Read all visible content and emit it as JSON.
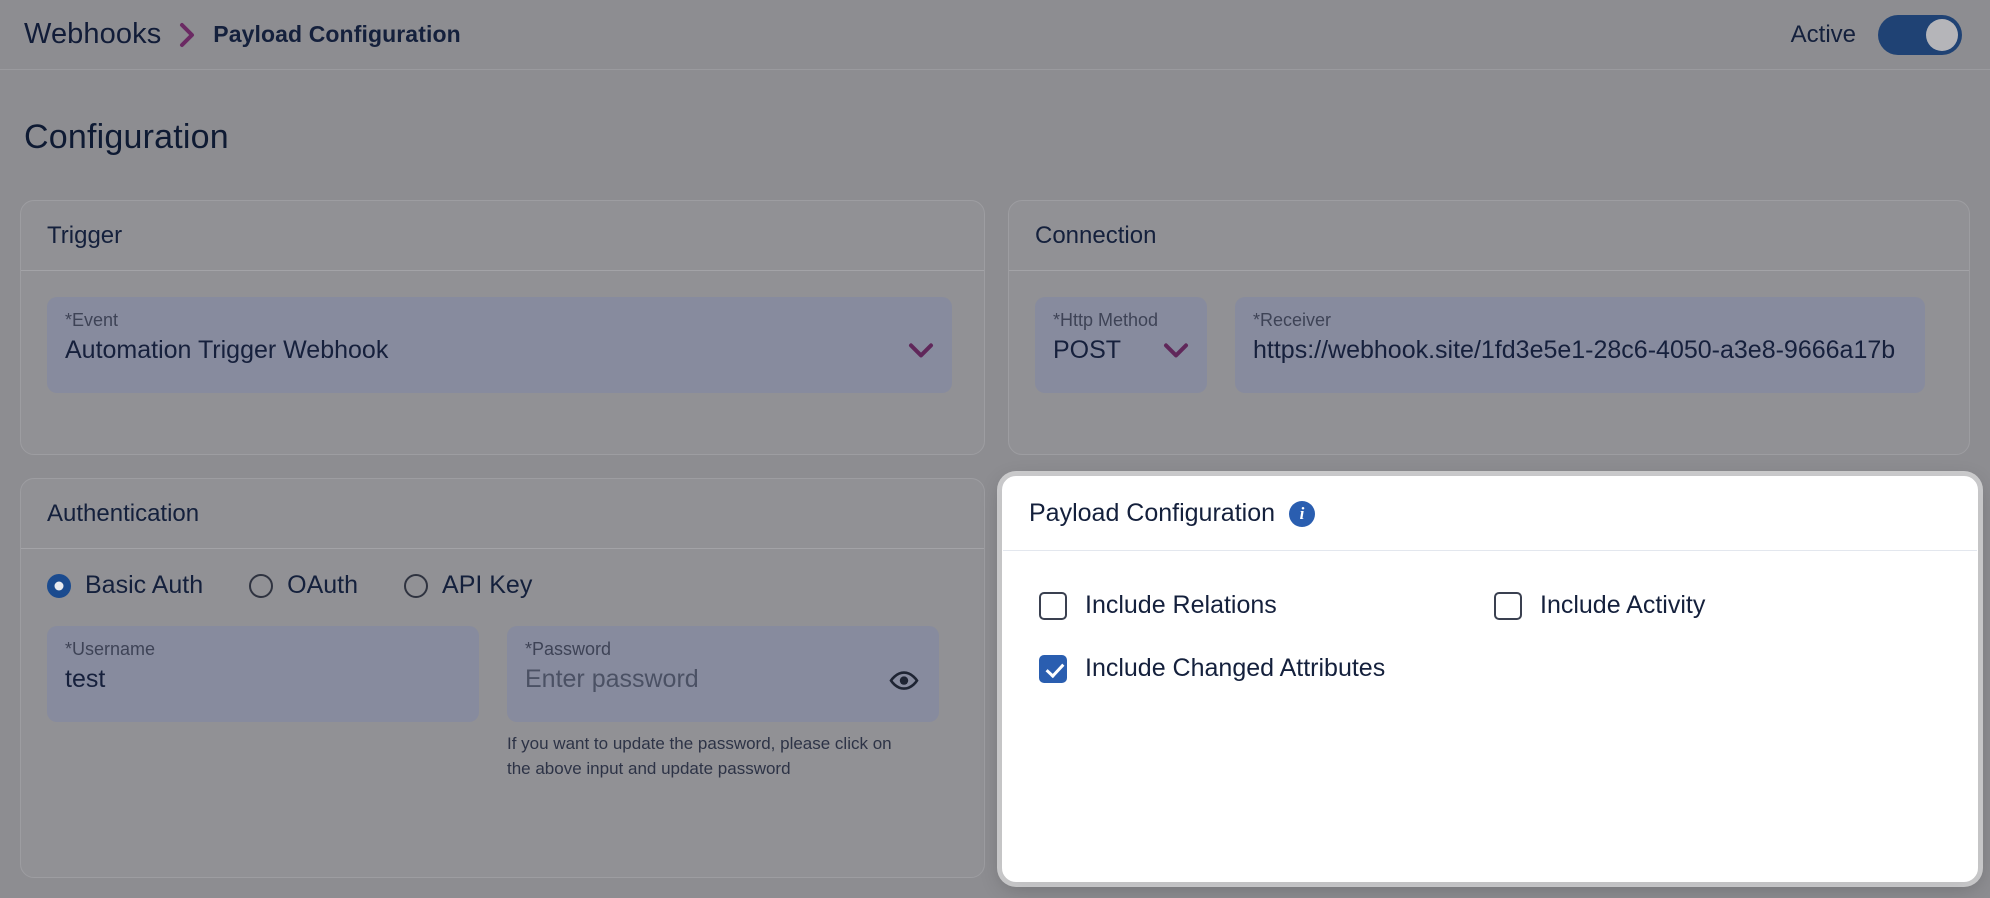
{
  "topbar": {
    "breadcrumb_root": "Webhooks",
    "breadcrumb_separator": "chevron-right-icon",
    "breadcrumb_leaf": "Payload Configuration",
    "active_label": "Active",
    "active_state": "on",
    "accent_purple": "#6b2a63",
    "toggle_on_color": "#1f4274"
  },
  "page": {
    "title": "Configuration",
    "backdrop_color": "#8d8d91",
    "card_color": "#919195",
    "field_color": "#878b9e",
    "text_color": "#14203c"
  },
  "trigger": {
    "title": "Trigger",
    "event": {
      "label": "*Event",
      "value": "Automation Trigger Webhook",
      "icon": "chevron-down-icon"
    }
  },
  "connection": {
    "title": "Connection",
    "http_method": {
      "label": "*Http Method",
      "value": "POST",
      "icon": "chevron-down-icon"
    },
    "receiver": {
      "label": "*Receiver",
      "value": "https://webhook.site/1fd3e5e1-28c6-4050-a3e8-9666a17b"
    }
  },
  "authentication": {
    "title": "Authentication",
    "options": [
      {
        "label": "Basic Auth",
        "selected": true
      },
      {
        "label": "OAuth",
        "selected": false
      },
      {
        "label": "API Key",
        "selected": false
      }
    ],
    "username": {
      "label": "*Username",
      "value": "test"
    },
    "password": {
      "label": "*Password",
      "placeholder": "Enter password",
      "icon": "eye-icon",
      "helper": "If you want to update the password, please click on the above input and update password"
    }
  },
  "payload": {
    "title": "Payload Configuration",
    "info_icon": "info-icon",
    "accent_blue": "#2a5eb0",
    "checkboxes": [
      {
        "label": "Include Relations",
        "checked": false
      },
      {
        "label": "Include Activity",
        "checked": false
      },
      {
        "label": "Include Changed Attributes",
        "checked": true
      }
    ]
  }
}
